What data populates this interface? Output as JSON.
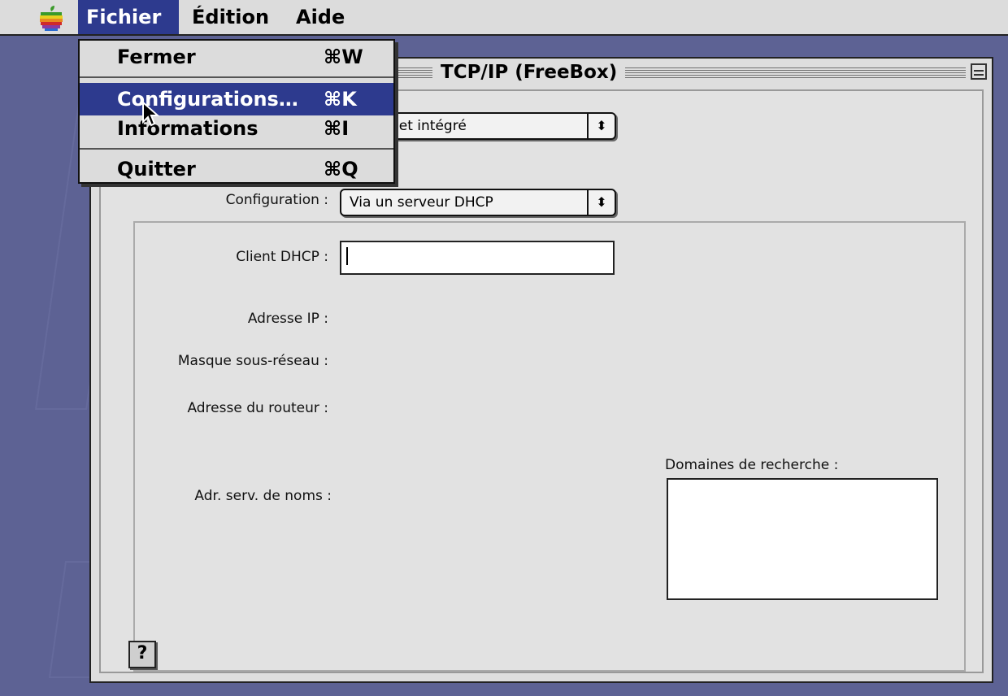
{
  "menubar": {
    "menus": [
      {
        "label": "Fichier",
        "active": true
      },
      {
        "label": "Édition",
        "active": false
      },
      {
        "label": "Aide",
        "active": false
      }
    ]
  },
  "dropdown": {
    "items": [
      {
        "label": "Fermer",
        "shortcut": "⌘W"
      },
      {
        "label": "Configurations…",
        "shortcut": "⌘K",
        "highlighted": true
      },
      {
        "label": "Informations",
        "shortcut": "⌘I"
      },
      {
        "label": "Quitter",
        "shortcut": "⌘Q"
      }
    ]
  },
  "window": {
    "title": "TCP/IP (FreeBox)",
    "connect_via_value": "net intégré",
    "configuration": {
      "label": "Configuration :",
      "value": "Via un serveur DHCP"
    },
    "dhcp_client": {
      "label": "Client DHCP :",
      "value": ""
    },
    "ip_address": {
      "label": "Adresse IP :"
    },
    "subnet_mask": {
      "label": "Masque sous-réseau :"
    },
    "router_address": {
      "label": "Adresse du routeur :"
    },
    "name_servers": {
      "label": "Adr. serv. de noms :"
    },
    "search_domains": {
      "label": "Domaines de recherche :",
      "value": ""
    },
    "help_button_glyph": "?"
  },
  "colors": {
    "desktop": "#5d6294",
    "highlight": "#2d3a8e",
    "chrome": "#dcdcdc"
  }
}
